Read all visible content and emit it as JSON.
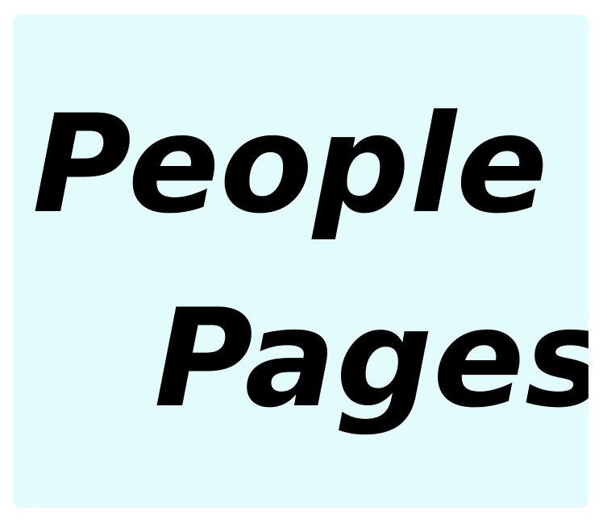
{
  "tile": {
    "line1": "People",
    "line2": "Pages",
    "background_color": "#e2fcfc",
    "text_color": "#000000"
  }
}
